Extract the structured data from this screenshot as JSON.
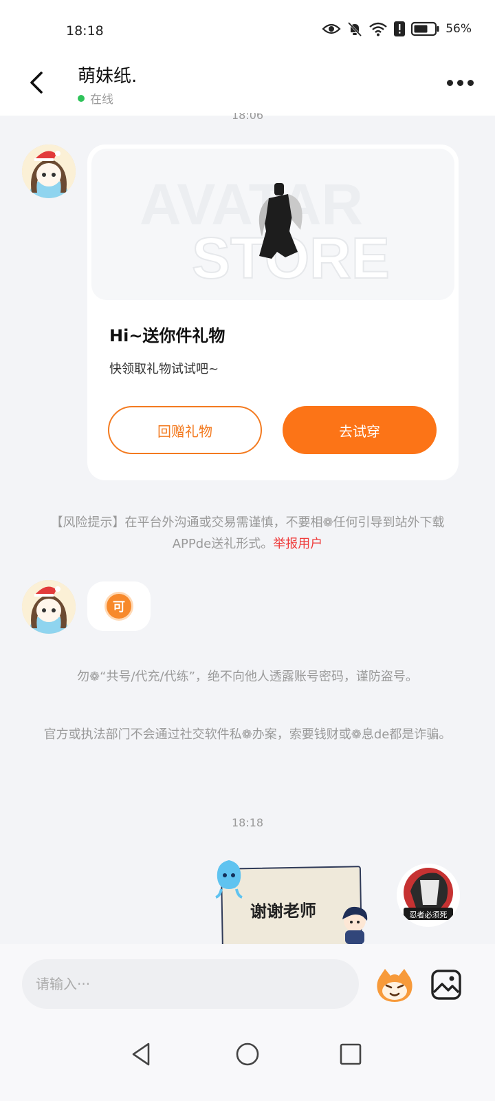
{
  "status_bar": {
    "time": "18:18",
    "battery_percent": "56%",
    "icons": [
      "eye-icon",
      "mute-bell-icon",
      "wifi-icon",
      "alert-icon",
      "battery-icon"
    ]
  },
  "header": {
    "contact_name": "萌妹纸.",
    "online_status": "在线",
    "back_icon": "chevron-left-icon",
    "more_icon": "more-dots-icon"
  },
  "chat": {
    "timestamp_top": "18:06",
    "gift_card": {
      "banner_text_1": "AVATAR",
      "banner_text_2": "STORE",
      "title": "Hi~送你件礼物",
      "subtitle": "快领取礼物试试吧~",
      "return_gift_label": "回赠礼物",
      "try_on_label": "去试穿"
    },
    "risk_notice": "【风险提示】在平台外沟通或交易需谨慎，不要相❁任何引导到站外下载APPde送礼形式。",
    "report_label": "举报用户",
    "emoji_char": "可",
    "warning_1": "勿❁“共号/代充/代练”，绝不向他人透露账号密码，谨防盗号。",
    "warning_2": "官方或执法部门不会通过社交软件私❁办案，索要钱财或❁息de都是诈骗。",
    "timestamp_bottom": "18:18",
    "sticker_text": "谢谢老师",
    "my_avatar_text": "忍者必须死"
  },
  "input": {
    "placeholder": "请输入···",
    "emoji_icon": "emoji-face-icon",
    "image_icon": "image-icon"
  },
  "nav": {
    "icons": [
      "nav-back-icon",
      "nav-home-icon",
      "nav-recent-icon"
    ]
  },
  "colors": {
    "accent": "#fc7417",
    "online": "#2fc35a",
    "report": "#ef3b3b",
    "background": "#f3f4f7"
  }
}
